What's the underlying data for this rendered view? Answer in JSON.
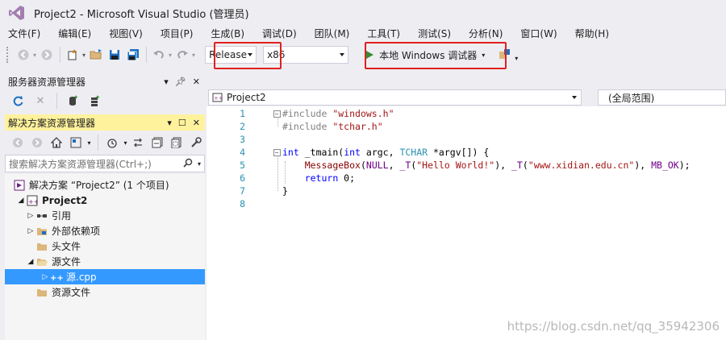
{
  "window": {
    "title": "Project2 - Microsoft Visual Studio (管理员)"
  },
  "menu": [
    "文件(F)",
    "编辑(E)",
    "视图(V)",
    "项目(P)",
    "生成(B)",
    "调试(D)",
    "团队(M)",
    "工具(T)",
    "测试(S)",
    "分析(N)",
    "窗口(W)",
    "帮助(H)"
  ],
  "toolbar": {
    "configuration": "Release",
    "platform": "x86",
    "debug_button": "本地 Windows 调试器"
  },
  "server_explorer": {
    "title": "服务器资源管理器"
  },
  "solution_explorer": {
    "title": "解决方案资源管理器",
    "search_placeholder": "搜索解决方案资源管理器(Ctrl+;)",
    "tree": {
      "solution": "解决方案 “Project2” (1 个项目)",
      "project": "Project2",
      "references": "引用",
      "external_deps": "外部依赖项",
      "header_files": "头文件",
      "source_files": "源文件",
      "source_cpp": "源.cpp",
      "resource_files": "资源文件"
    }
  },
  "editor": {
    "file_scope": "Project2",
    "global_scope": "(全局范围)",
    "line_numbers": [
      "1",
      "2",
      "3",
      "4",
      "5",
      "6",
      "7",
      "8"
    ],
    "code": {
      "l1_directive": "#include",
      "l1_file": "\"windows.h\"",
      "l2_directive": "#include",
      "l2_file": "\"tchar.h\"",
      "l4_int": "int",
      "l4_fn": "_tmain",
      "l4_args_a": "(",
      "l4_int2": "int",
      "l4_args_b": " argc, ",
      "l4_tchar": "TCHAR",
      "l4_args_c": " *argv[]) {",
      "l5_fn": "MessageBox",
      "l5_a": "(",
      "l5_null": "NULL",
      "l5_b": ", ",
      "l5_t1": "_T",
      "l5_c": "(",
      "l5_s1": "\"Hello World!\"",
      "l5_d": "), ",
      "l5_t2": "_T",
      "l5_e": "(",
      "l5_s2": "\"www.xidian.edu.cn\"",
      "l5_f": "), ",
      "l5_mbok": "MB_OK",
      "l5_g": ");",
      "l6_return": "return",
      "l6_rest": " 0;",
      "l7": "}"
    }
  },
  "watermark": "https://blog.csdn.net/qq_35942306",
  "colors": {
    "highlight": "#e02020",
    "selection": "#3399ff",
    "active_panel": "#fff29d"
  }
}
